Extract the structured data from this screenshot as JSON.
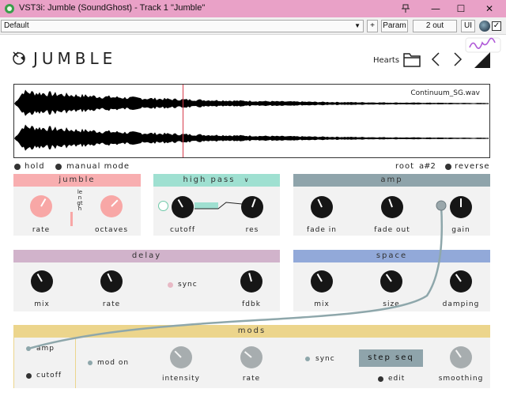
{
  "window": {
    "title": "VST3i: Jumble (SoundGhost) - Track 1 \"Jumble\"",
    "pin_icon": "pin-icon",
    "minimize": "—",
    "maximize": "☐",
    "close": "✕"
  },
  "host": {
    "preset": "Default",
    "plus": "+",
    "param": "Param",
    "output": "2 out",
    "ui": "UI"
  },
  "plugin": {
    "name": "JUMBLE",
    "preset_name": "Hearts",
    "waveform": {
      "filename": "Continuum_SG.wav",
      "playhead_fraction": 0.354
    },
    "options": {
      "hold": "hold",
      "manual_mode": "manual mode",
      "root_label": "root",
      "root_value": "a#2",
      "reverse": "reverse"
    },
    "jumble": {
      "header": "jumble",
      "rate": "rate",
      "length": "length",
      "octaves": "octaves"
    },
    "highpass": {
      "header": "high pass",
      "cutoff": "cutoff",
      "res": "res"
    },
    "amp": {
      "header": "amp",
      "fade_in": "fade in",
      "fade_out": "fade out",
      "gain": "gain"
    },
    "delay": {
      "header": "delay",
      "mix": "mix",
      "rate": "rate",
      "sync": "sync",
      "fdbk": "fdbk"
    },
    "space": {
      "header": "space",
      "mix": "mix",
      "size": "size",
      "damping": "damping"
    },
    "mods": {
      "header": "mods",
      "amp": "amp",
      "cutoff": "cutoff",
      "mod_on": "mod on",
      "intensity": "intensity",
      "rate": "rate",
      "sync": "sync",
      "step_seq": "step seq",
      "edit": "edit",
      "smoothing": "smoothing"
    }
  },
  "colors": {
    "titlebar": "#e9a1c7",
    "jumble": "#f8aeb0",
    "highpass": "#9fe0d1",
    "amp": "#8fa4ab",
    "delay": "#d1b3cb",
    "space": "#92a9d9",
    "mods": "#ecd58c",
    "pink_knob": "#f8a7a6",
    "gray_knob": "#a7adaf",
    "cable": "#8ea7ab"
  }
}
